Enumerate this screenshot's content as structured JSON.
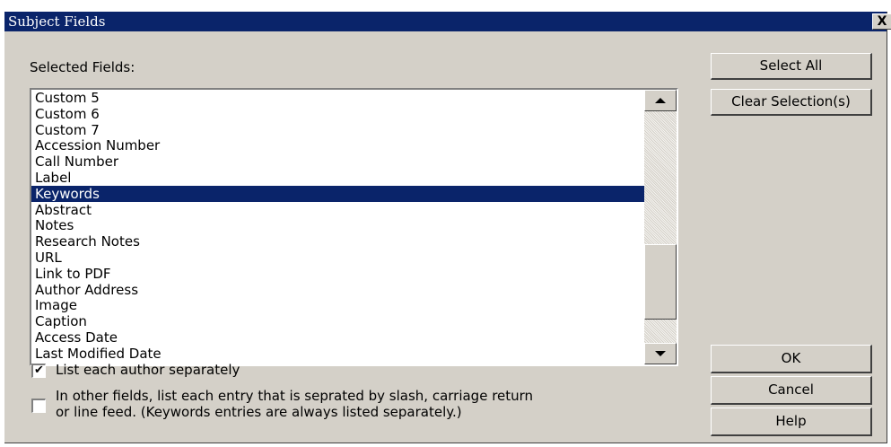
{
  "dialog": {
    "title": "Subject Fields",
    "close_label": "X"
  },
  "fields_list": {
    "label": "Selected Fields:",
    "items": [
      "Custom 5",
      "Custom 6",
      "Custom 7",
      "Accession Number",
      "Call Number",
      "Label",
      "Keywords",
      "Abstract",
      "Notes",
      "Research Notes",
      "URL",
      "Link to PDF",
      "Author Address",
      "Image",
      "Caption",
      "Access Date",
      "Last Modified Date"
    ],
    "selected_item": "Keywords"
  },
  "buttons": {
    "select_all": "Select All",
    "clear_selection": "Clear Selection(s)",
    "ok": "OK",
    "cancel": "Cancel",
    "help": "Help"
  },
  "options": {
    "list_authors_separately": {
      "label": "List each author separately",
      "checked": true
    },
    "list_entries_separately": {
      "line1": "In other fields, list each entry that is seprated by slash, carriage return",
      "line2": "or line feed. (Keywords entries are always listed separately.)",
      "checked": false
    }
  },
  "colors": {
    "dialog_bg": "#d4d0c8",
    "titlebar_bg": "#0a246a",
    "selection_bg": "#0a246a"
  }
}
